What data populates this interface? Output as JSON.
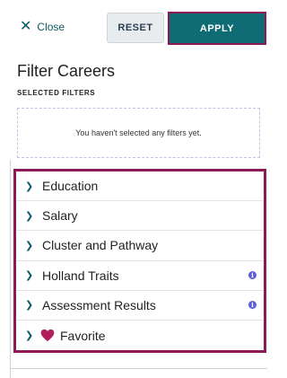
{
  "header": {
    "close_label": "Close",
    "reset_label": "RESET",
    "apply_label": "APPLY"
  },
  "title": "Filter Careers",
  "selected_filters": {
    "label": "SELECTED FILTERS",
    "empty_message": "You haven't selected any filters yet."
  },
  "filters": [
    {
      "label": "Education",
      "icon": "chevron-right-icon"
    },
    {
      "label": "Salary",
      "icon": "chevron-right-icon"
    },
    {
      "label": "Cluster and Pathway",
      "icon": "chevron-right-icon"
    },
    {
      "label": "Holland Traits",
      "icon": "chevron-right-icon",
      "info": true
    },
    {
      "label": "Assessment Results",
      "icon": "chevron-right-icon",
      "info": true
    },
    {
      "label": "Favorite",
      "icon": "chevron-right-icon",
      "heart": true
    }
  ],
  "colors": {
    "primary": "#0f6b74",
    "focus_outline": "#8e1a55",
    "heart": "#b01e5c",
    "info": "#5d5fd6"
  }
}
